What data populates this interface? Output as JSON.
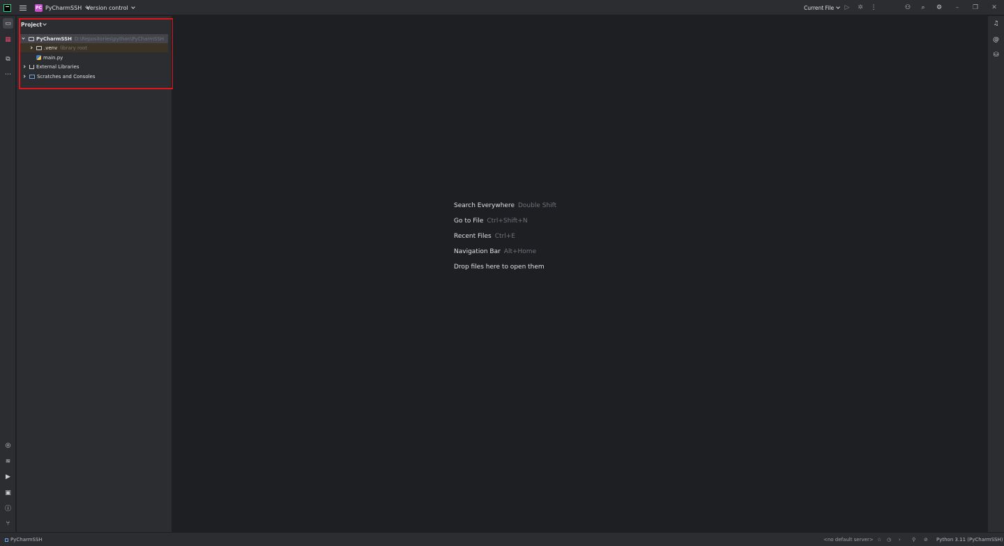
{
  "titlebar": {
    "project_name": "PyCharmSSH",
    "project_badge": "PC",
    "vcs_label": "Version control",
    "run_config": "Current File"
  },
  "project_panel": {
    "title": "Project",
    "tree": [
      {
        "label": "PyCharmSSH",
        "detail": "D:\\Repositories\\python\\PyCharmSSH"
      },
      {
        "label": ".venv",
        "detail": "library root"
      },
      {
        "label": "main.py",
        "detail": ""
      },
      {
        "label": "External Libraries",
        "detail": ""
      },
      {
        "label": "Scratches and Consoles",
        "detail": ""
      }
    ]
  },
  "editor": {
    "hints": [
      {
        "action": "Search Everywhere",
        "shortcut": "Double Shift"
      },
      {
        "action": "Go to File",
        "shortcut": "Ctrl+Shift+N"
      },
      {
        "action": "Recent Files",
        "shortcut": "Ctrl+E"
      },
      {
        "action": "Navigation Bar",
        "shortcut": "Alt+Home"
      },
      {
        "action": "Drop files here to open them",
        "shortcut": ""
      }
    ]
  },
  "statusbar": {
    "breadcrumb": "PyCharmSSH",
    "server": "<no default server>",
    "interpreter": "Python 3.11 (PyCharmSSH)"
  },
  "colors": {
    "highlight_border": "#e0151c",
    "project_badge": "#c94fcf"
  }
}
